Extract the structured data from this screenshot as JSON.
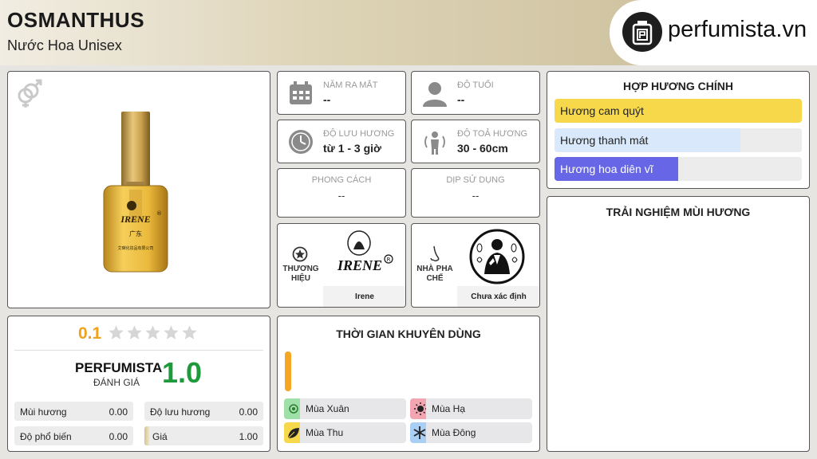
{
  "header": {
    "title": "OSMANTHUS ",
    "subtitle": "Nước Hoa Unisex",
    "logo_text": "perfumista.vn"
  },
  "stats": {
    "release_year": {
      "label": "NĂM RA MẮT",
      "value": "--",
      "icon": "calendar-icon"
    },
    "age": {
      "label": "ĐỘ TUỔI",
      "value": "--",
      "icon": "person-icon"
    },
    "longevity": {
      "label": "ĐỘ LƯU HƯƠNG",
      "value": "từ 1 - 3 giờ",
      "icon": "clock-icon"
    },
    "sillage": {
      "label": "ĐỘ TOẢ HƯƠNG",
      "value": "30 - 60cm",
      "icon": "sillage-icon"
    },
    "style": {
      "label": "PHONG CÁCH",
      "value": "--"
    },
    "occasion": {
      "label": "DỊP SỬ DỤNG",
      "value": "--"
    }
  },
  "brand": {
    "label": "THƯƠNG HIỆU",
    "name": "Irene ",
    "logo_text": "IRENE"
  },
  "perfumer": {
    "label": "NHÀ PHA CHẾ",
    "name": "Chưa xác định"
  },
  "accords": {
    "title": "HỢP HƯƠNG CHÍNH",
    "items": [
      {
        "label": "Hương cam quýt",
        "level": 1.0,
        "color": "#f7d84a"
      },
      {
        "label": "Hương thanh mát",
        "level": 0.75,
        "color": "#d9e8fb"
      },
      {
        "label": "Hương hoa diên vĩ",
        "level": 0.5,
        "color": "#6666e6"
      }
    ]
  },
  "experience": {
    "title": "TRẢI NGHIỆM MÙI HƯƠNG"
  },
  "rating": {
    "user_score": "0.1",
    "stars_filled": 0,
    "brand_label": "PERFUMISTA",
    "eval_label": "ĐÁNH GIÁ",
    "score": "1.0",
    "rows": [
      {
        "label": "Mùi hương",
        "value": "0.00"
      },
      {
        "label": "Độ lưu hương",
        "value": "0.00"
      },
      {
        "label": "Độ phổ biến",
        "value": "0.00"
      },
      {
        "label": "Giá",
        "value": "1.00"
      }
    ]
  },
  "recommend": {
    "title": "THỜI GIAN KHUYÊN DÙNG",
    "day_night_color": "#f5a623",
    "seasons": [
      {
        "label": "Mùa Xuân",
        "color": "#9fe0a8"
      },
      {
        "label": "Mùa Hạ",
        "color": "#f3a6b2"
      },
      {
        "label": "Mùa Thu",
        "color": "#f5d94b"
      },
      {
        "label": "Mùa Đông",
        "color": "#a9cff5"
      }
    ]
  }
}
